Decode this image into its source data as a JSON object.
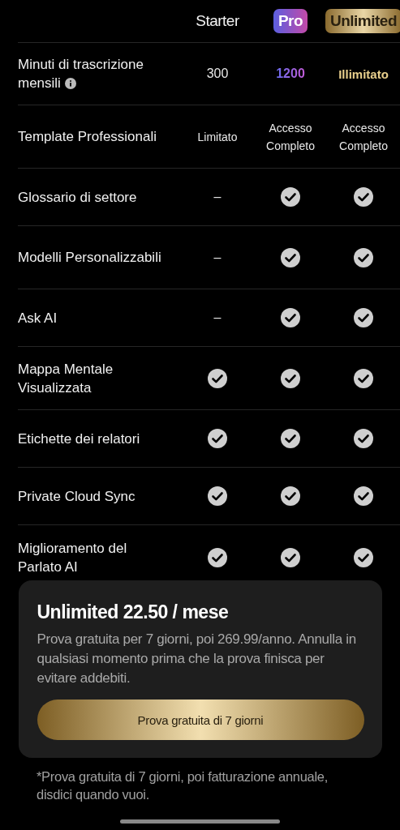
{
  "plans": [
    {
      "name": "Starter",
      "kind": "plain"
    },
    {
      "name": "Pro",
      "kind": "pro"
    },
    {
      "name": "Unlimited",
      "kind": "gold"
    }
  ],
  "features": [
    {
      "label": "Minuti di trascrizione mensili",
      "info": true,
      "cells": [
        {
          "kind": "plain-text",
          "text": "300"
        },
        {
          "kind": "pro-text",
          "text": "1200"
        },
        {
          "kind": "gold-text",
          "text": "Illimitato"
        }
      ]
    },
    {
      "label": "Template Professionali",
      "info": false,
      "cells": [
        {
          "kind": "small-text",
          "text": "Limitato"
        },
        {
          "kind": "small-text",
          "text": "Accesso Completo"
        },
        {
          "kind": "small-text",
          "text": "Accesso Completo"
        }
      ]
    },
    {
      "label": "Glossario di settore",
      "info": false,
      "cells": [
        {
          "kind": "dash",
          "text": "–"
        },
        {
          "kind": "check"
        },
        {
          "kind": "check"
        }
      ]
    },
    {
      "label": "Modelli Personalizzabili",
      "info": false,
      "cells": [
        {
          "kind": "dash",
          "text": "–"
        },
        {
          "kind": "check"
        },
        {
          "kind": "check"
        }
      ]
    },
    {
      "label": "Ask AI",
      "info": false,
      "cells": [
        {
          "kind": "dash",
          "text": "–"
        },
        {
          "kind": "check"
        },
        {
          "kind": "check"
        }
      ]
    },
    {
      "label": "Mappa Mentale Visualizzata",
      "info": false,
      "cells": [
        {
          "kind": "check"
        },
        {
          "kind": "check"
        },
        {
          "kind": "check"
        }
      ]
    },
    {
      "label": "Etichette dei relatori",
      "info": false,
      "cells": [
        {
          "kind": "check"
        },
        {
          "kind": "check"
        },
        {
          "kind": "check"
        }
      ]
    },
    {
      "label": "Private Cloud Sync",
      "info": false,
      "cells": [
        {
          "kind": "check"
        },
        {
          "kind": "check"
        },
        {
          "kind": "check"
        }
      ]
    },
    {
      "label": "Miglioramento del Parlato AI",
      "info": false,
      "cells": [
        {
          "kind": "check"
        },
        {
          "kind": "check"
        },
        {
          "kind": "check"
        }
      ]
    }
  ],
  "offer": {
    "title": "Unlimited 22.50 / mese",
    "description": "Prova gratuita per 7 giorni, poi 269.99/anno. Annulla in qualsiasi momento prima che la prova finisca per evitare addebiti.",
    "button": "Prova gratuita di 7 giorni"
  },
  "footnote": "*Prova gratuita di 7 giorni, poi fatturazione annuale, disdici quando vuoi."
}
